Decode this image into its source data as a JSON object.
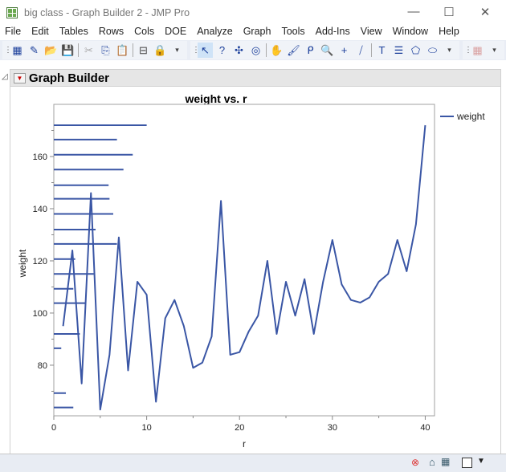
{
  "window": {
    "title": "big class - Graph Builder 2 - JMP Pro"
  },
  "menu": [
    "File",
    "Edit",
    "Tables",
    "Rows",
    "Cols",
    "DOE",
    "Analyze",
    "Graph",
    "Tools",
    "Add-Ins",
    "View",
    "Window",
    "Help"
  ],
  "panel": {
    "title": "Graph Builder"
  },
  "colors": {
    "series": "#3a56a5"
  },
  "chart_data": {
    "type": "line",
    "title": "weight vs. r",
    "xlabel": "r",
    "ylabel": "weight",
    "xlim": [
      0,
      41
    ],
    "ylim": [
      60.6,
      180
    ],
    "xticks": [
      0,
      10,
      20,
      30,
      40
    ],
    "yticks": [
      80,
      100,
      120,
      140,
      160
    ],
    "legend": {
      "position": "right",
      "entries": [
        "weight"
      ]
    },
    "series": [
      {
        "name": "weight",
        "x": [
          1,
          2,
          3,
          4,
          5,
          6,
          7,
          8,
          9,
          10,
          11,
          12,
          13,
          14,
          15,
          16,
          17,
          18,
          19,
          20,
          21,
          22,
          23,
          24,
          25,
          26,
          27,
          28,
          29,
          30,
          31,
          32,
          33,
          34,
          35,
          36,
          37,
          38,
          39,
          40
        ],
        "y": [
          95,
          124,
          73,
          146,
          63,
          84,
          129,
          78,
          112,
          107,
          66,
          98,
          105,
          95,
          79,
          81,
          91,
          143,
          84,
          85,
          93,
          99,
          120,
          92,
          112,
          99,
          113,
          92,
          112,
          128,
          111,
          105,
          104,
          106,
          112,
          115,
          128,
          116,
          134,
          172
        ]
      }
    ],
    "horizontal_segments": {
      "x_start": 0,
      "y": [
        172,
        166.5,
        160.7,
        155,
        149,
        143.8,
        138,
        132,
        126.5,
        120.7,
        115,
        109.3,
        103.8,
        92,
        86.5,
        69.3,
        63.8
      ],
      "x_end": [
        10.0,
        6.8,
        8.5,
        7.5,
        5.9,
        6.0,
        6.4,
        4.5,
        6.8,
        2.3,
        4.3,
        2.1,
        3.5,
        2.8,
        0.8,
        1.3,
        2.1
      ]
    }
  }
}
